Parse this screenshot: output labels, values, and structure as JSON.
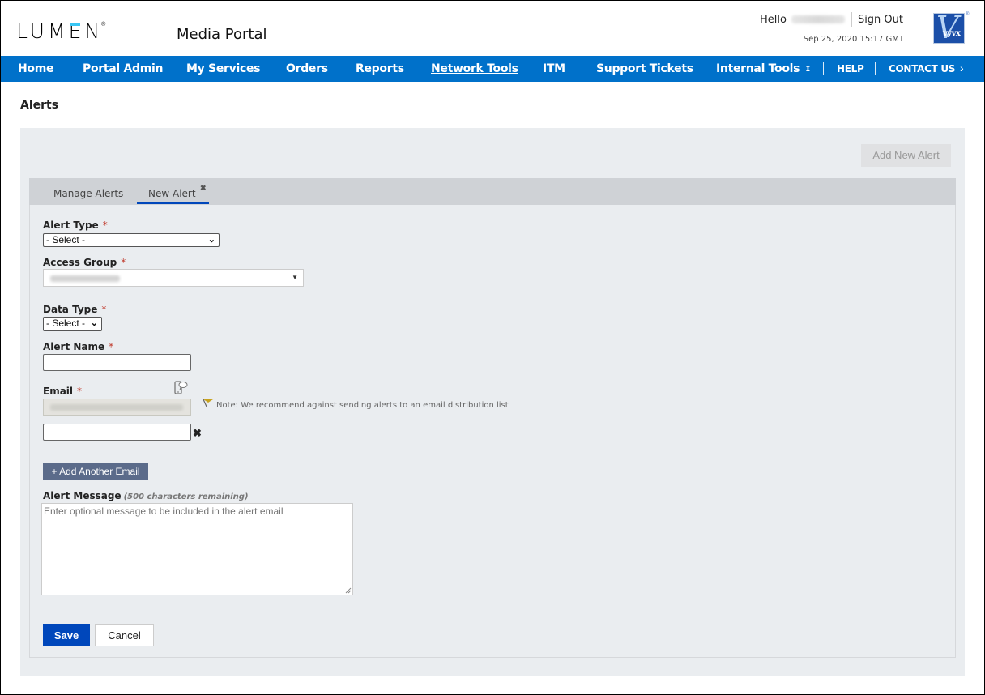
{
  "header": {
    "brand": "LUMEN",
    "brand_reg": "®",
    "portal_title": "Media Portal",
    "greeting": "Hello",
    "sign_out": "Sign Out",
    "datetime": "Sep 25, 2020 15:17 GMT",
    "partner_logo": {
      "letter": "V",
      "text": "vyvx",
      "reg": "®"
    }
  },
  "nav": {
    "items": [
      {
        "label": "Home"
      },
      {
        "label": "Portal Admin"
      },
      {
        "label": "My Services"
      },
      {
        "label": "Orders"
      },
      {
        "label": "Reports"
      },
      {
        "label": "Network Tools",
        "active": true
      },
      {
        "label": "ITM"
      },
      {
        "label": "Support Tickets"
      },
      {
        "label": "Internal Tools"
      }
    ],
    "overflow_glyph": "ı",
    "help": "HELP",
    "contact": "CONTACT US",
    "chevron": "›",
    "color": "#0071ca"
  },
  "page": {
    "title": "Alerts",
    "add_new_alert": "Add New Alert"
  },
  "tabs": [
    {
      "label": "Manage Alerts",
      "active": false
    },
    {
      "label": "New Alert",
      "active": true,
      "closable": true,
      "close_glyph": "✖"
    }
  ],
  "form": {
    "required_marker": "*",
    "alert_type": {
      "label": "Alert Type",
      "value": "- Select -"
    },
    "access_group": {
      "label": "Access Group",
      "value": "(redacted)"
    },
    "data_type": {
      "label": "Data Type",
      "value": "- Select -"
    },
    "alert_name": {
      "label": "Alert Name",
      "value": ""
    },
    "email": {
      "label": "Email",
      "prefilled_value": "(redacted)",
      "note": "Note: We recommend against sending alerts to an email distribution list",
      "additional_value": "",
      "remove_glyph": "✖"
    },
    "add_email_button": "+ Add Another Email",
    "alert_message": {
      "label": "Alert Message",
      "remaining": "(500 characters remaining)",
      "placeholder": "Enter optional message to be included in the alert email"
    },
    "save": "Save",
    "cancel": "Cancel"
  },
  "colors": {
    "primary_button": "#0047bb",
    "secondary_button": "#5b6b8a",
    "nav_bg": "#0071ca",
    "panel_bg": "#eaedf0",
    "tab_bar_bg": "#cfd2d6",
    "required": "#c0392b",
    "note_flag": "#c8a21e"
  }
}
